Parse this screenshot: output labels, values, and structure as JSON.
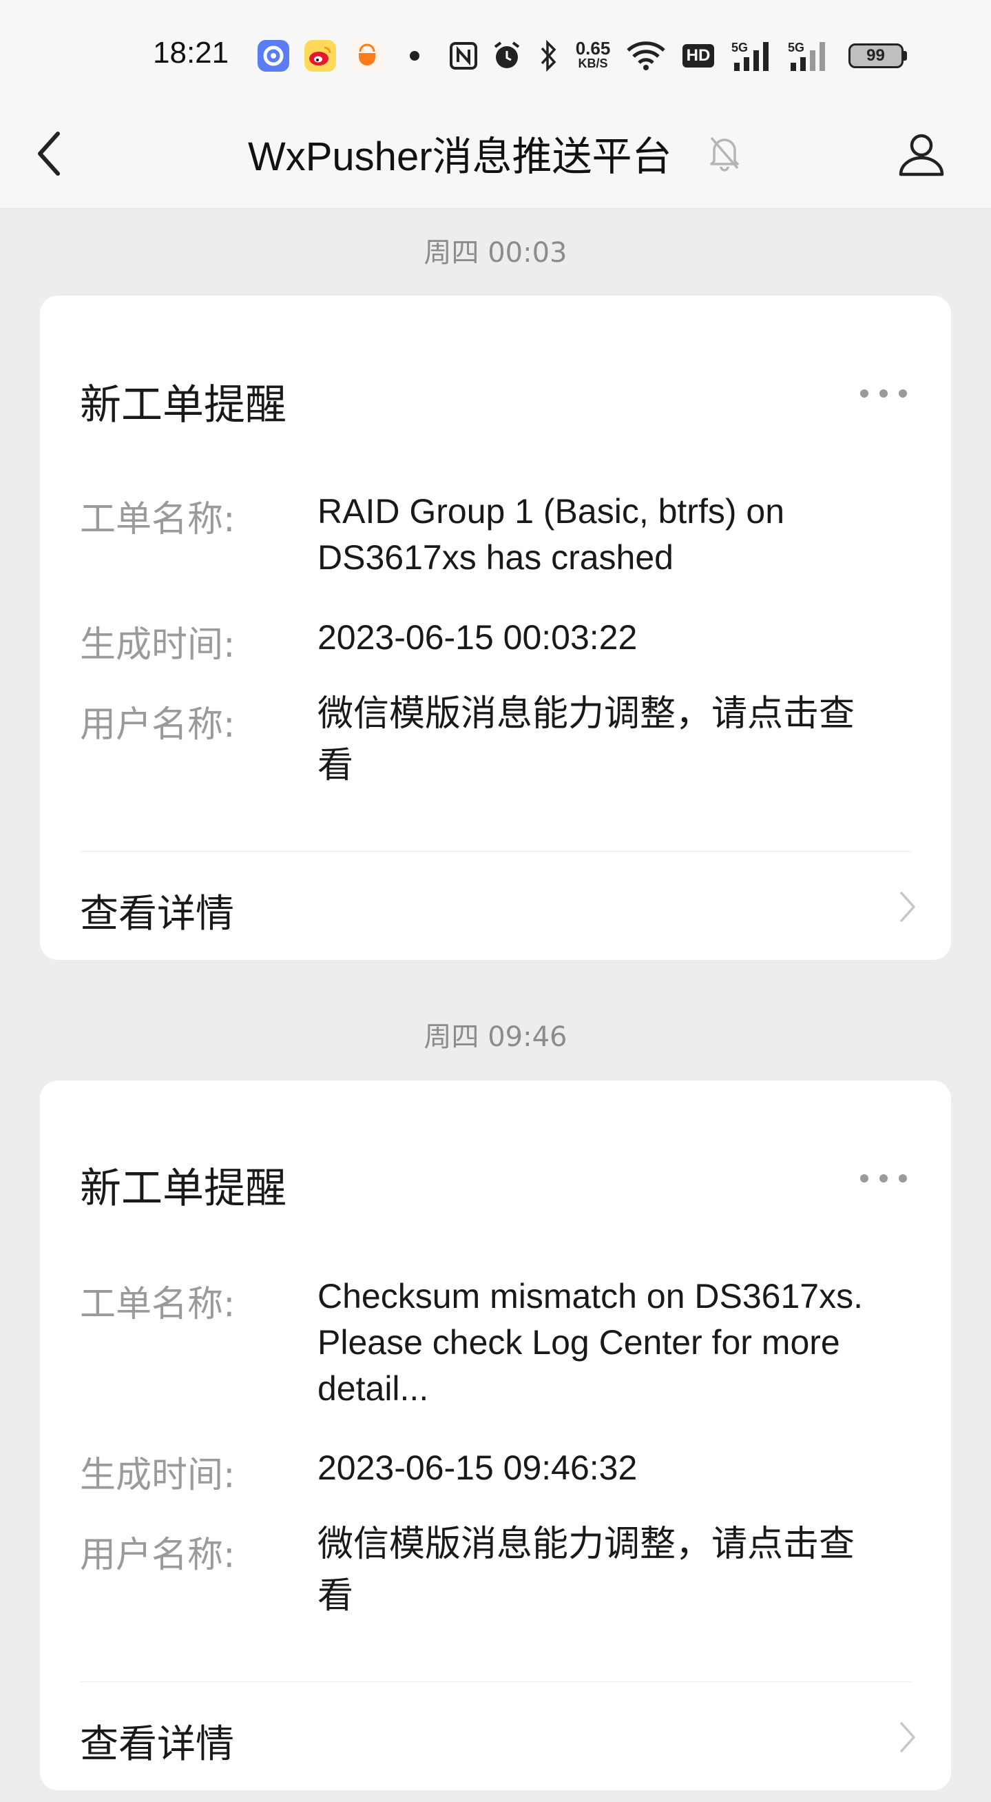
{
  "status_bar": {
    "time": "18:21",
    "net_speed_value": "0.65",
    "net_speed_unit": "KB/S",
    "battery": "99",
    "net_a": "5G",
    "net_b": "5G",
    "hd": "HD",
    "icons": [
      "browser-app-icon",
      "weibo-app-icon",
      "didi-app-icon",
      "dot-icon",
      "nfc-icon",
      "alarm-icon",
      "bluetooth-icon",
      "wifi-icon",
      "hd-icon",
      "signal-icon",
      "signal-icon",
      "battery-icon"
    ]
  },
  "nav": {
    "title": "WxPusher消息推送平台",
    "back_icon": "chevron-left-icon",
    "mute_icon": "bell-off-icon",
    "profile_icon": "user-icon"
  },
  "messages": [
    {
      "timestamp": "周四 00:03",
      "card": {
        "title": "新工单提醒",
        "rows": [
          {
            "label": "工单名称:",
            "value_lines": [
              "RAID Group 1 (Basic, btrfs) on",
              "DS3617xs has crashed"
            ]
          },
          {
            "label": "生成时间:",
            "value_lines": [
              "2023-06-15 00:03:22"
            ]
          },
          {
            "label": "用户名称:",
            "value_lines": [
              "微信模版消息能力调整，请点击查",
              "看"
            ]
          }
        ],
        "details_label": "查看详情"
      }
    },
    {
      "timestamp": "周四 09:46",
      "card": {
        "title": "新工单提醒",
        "rows": [
          {
            "label": "工单名称:",
            "value_lines": [
              "Checksum mismatch on DS3617xs.",
              "Please check Log Center for more",
              "detail..."
            ]
          },
          {
            "label": "生成时间:",
            "value_lines": [
              "2023-06-15 09:46:32"
            ]
          },
          {
            "label": "用户名称:",
            "value_lines": [
              "微信模版消息能力调整，请点击查",
              "看"
            ]
          }
        ],
        "details_label": "查看详情"
      }
    }
  ]
}
